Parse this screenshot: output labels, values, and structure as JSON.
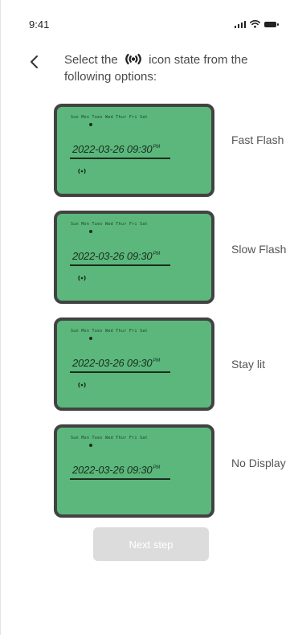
{
  "status_bar": {
    "time": "9:41"
  },
  "header": {
    "instruction_before": "Select the",
    "instruction_after": " icon state from the following options:"
  },
  "lcd": {
    "days": "Sun  Mon  Tues  Wed  Thur  Fri  Sat",
    "datetime": "2022-03-26 09:30",
    "datetime_sup": "PM"
  },
  "options": [
    {
      "label": "Fast Flash",
      "icon_visible": true
    },
    {
      "label": "Slow Flash",
      "icon_visible": true
    },
    {
      "label": "Stay lit",
      "icon_visible": true
    },
    {
      "label": "No Display",
      "icon_visible": false
    }
  ],
  "footer": {
    "next_label": "Next step"
  },
  "colors": {
    "lcd_green": "#5bb77c",
    "lcd_border": "#424242",
    "button_disabled": "#dcdcdc"
  }
}
